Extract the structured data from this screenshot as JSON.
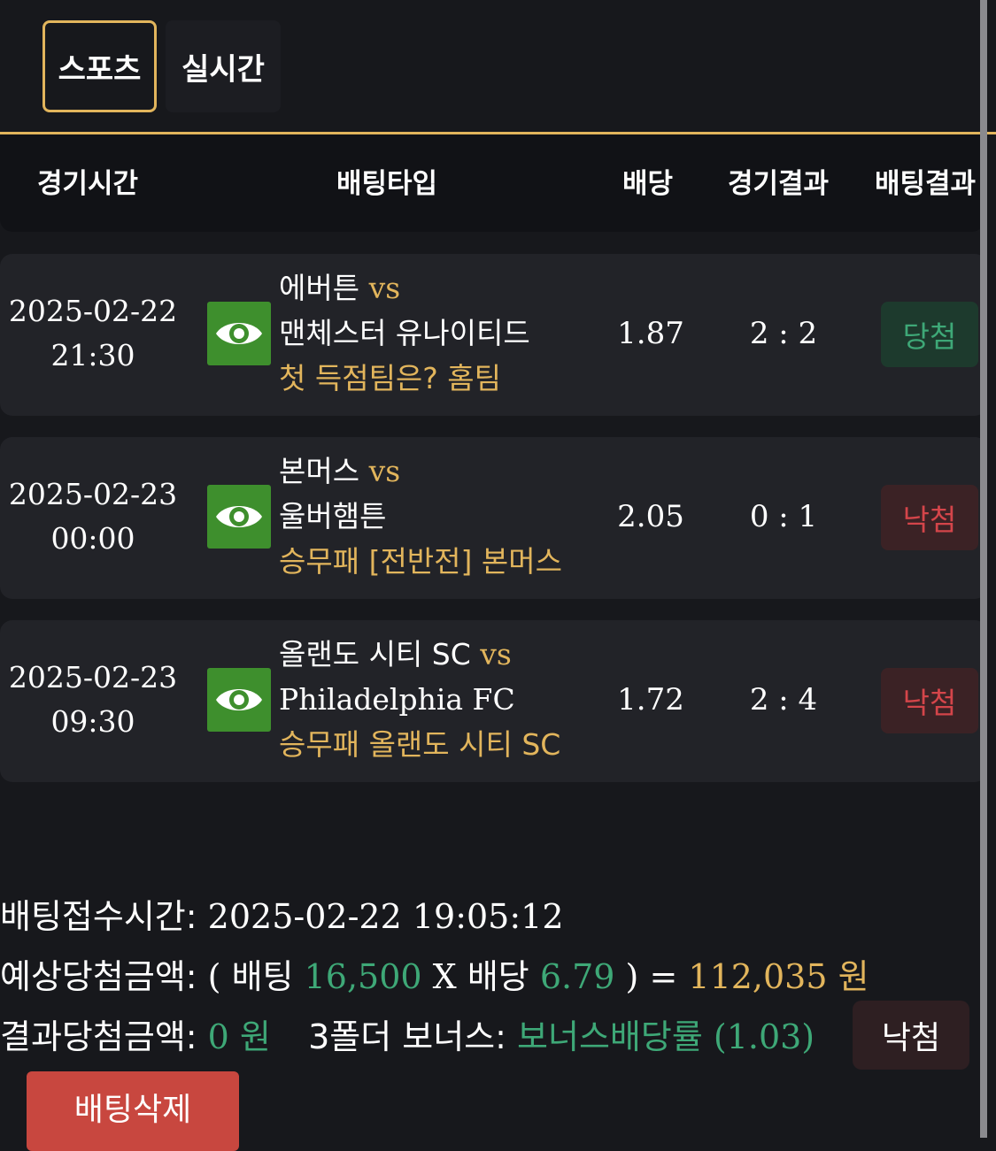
{
  "tabs": {
    "sports": "스포츠",
    "live": "실시간"
  },
  "header": {
    "time": "경기시간",
    "bet_type": "배팅타입",
    "odds": "배당",
    "match_result": "경기결과",
    "bet_result": "배팅결과"
  },
  "rows": [
    {
      "date": "2025-02-22",
      "time": "21:30",
      "home": "에버튼",
      "vs": "vs",
      "away": "맨체스터 유나이티드",
      "pick": "첫 득점팀은? 홈팀",
      "odds": "1.87",
      "score": "2 : 2",
      "result": "당첨"
    },
    {
      "date": "2025-02-23",
      "time": "00:00",
      "home": "본머스",
      "vs": "vs",
      "away": "울버햄튼",
      "pick": "승무패 [전반전] 본머스",
      "odds": "2.05",
      "score": "0 : 1",
      "result": "낙첨"
    },
    {
      "date": "2025-02-23",
      "time": "09:30",
      "home": "올랜도 시티 SC",
      "vs": "vs",
      "away": "Philadelphia FC",
      "pick": "승무패 올랜도 시티 SC",
      "odds": "1.72",
      "score": "2 : 4",
      "result": "낙첨"
    }
  ],
  "summary": {
    "received_label": "배팅접수시간:",
    "received_value": "2025-02-22 19:05:12",
    "expected_label": "예상당첨금액:",
    "open_paren": "(",
    "bet_word": "배팅",
    "bet_amount": "16,500",
    "times": "X",
    "odds_word": "배당",
    "total_odds": "6.79",
    "close_eq": ") =",
    "expected_amount": "112,035 원",
    "result_label": "결과당첨금액:",
    "result_amount": "0 원",
    "bonus_label": "3폴더 보너스:",
    "bonus_value": "보너스배당률 (1.03)",
    "status_button": "낙첨",
    "delete_button": "배팅삭제"
  },
  "colors": {
    "accent_gold": "#e2b55c",
    "win_green": "#3ea877",
    "lose_red": "#d4454a",
    "eye_button": "#3e8f2d",
    "delete_button": "#c8473f"
  },
  "icons": {
    "view": "eye-icon"
  }
}
